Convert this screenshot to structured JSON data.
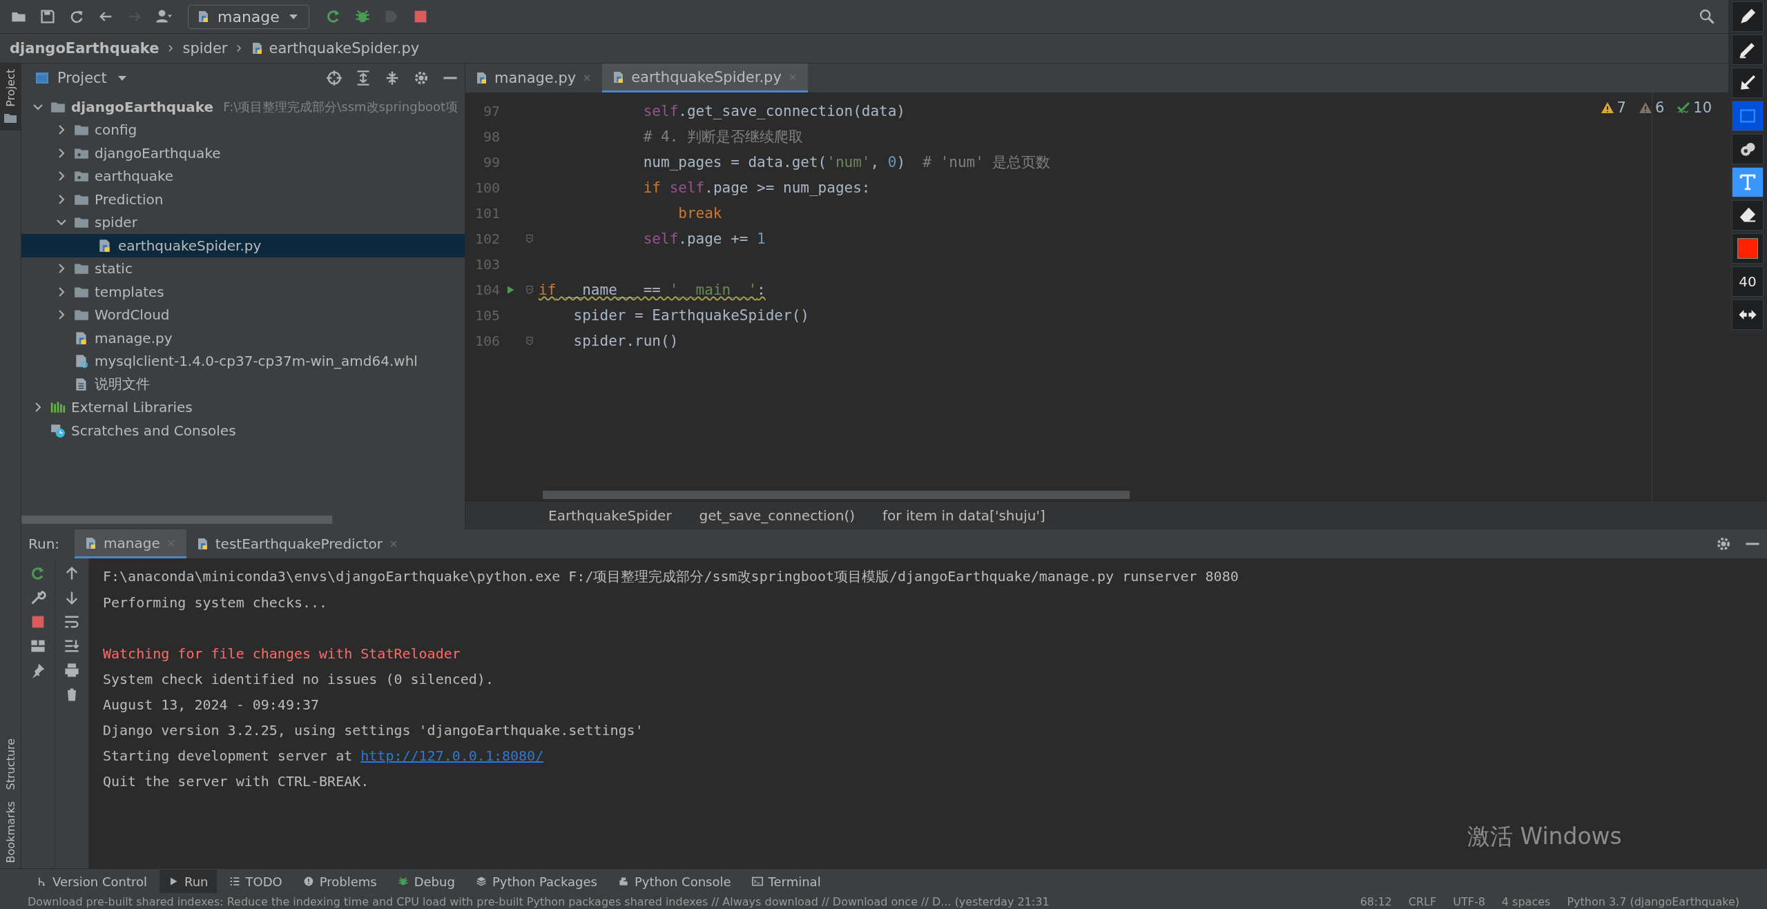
{
  "toolbar": {
    "run_config": "manage",
    "tools": [
      {
        "kind": "open",
        "disabled": false
      },
      {
        "kind": "save",
        "disabled": false
      },
      {
        "kind": "sync",
        "disabled": false
      },
      {
        "kind": "back",
        "disabled": false
      },
      {
        "kind": "forward",
        "disabled": true
      },
      {
        "kind": "user",
        "disabled": false
      }
    ],
    "run_tools": [
      {
        "kind": "rerun",
        "disabled": false
      },
      {
        "kind": "debug",
        "disabled": false
      },
      {
        "kind": "coverage",
        "disabled": true
      },
      {
        "kind": "stop",
        "disabled": false
      }
    ]
  },
  "breadcrumb": [
    {
      "label": "djangoEarthquake",
      "kind": "project"
    },
    {
      "label": "spider",
      "kind": "folder"
    },
    {
      "label": "earthquakeSpider.py",
      "kind": "pyfile"
    }
  ],
  "left_strip": {
    "top": [
      {
        "label": "Project",
        "selected": true
      }
    ],
    "bottom": [
      {
        "label": "Structure",
        "selected": false
      },
      {
        "label": "Bookmarks",
        "selected": false
      }
    ]
  },
  "project": {
    "title": "Project",
    "tree": [
      {
        "label": "djangoEarthquake",
        "path": "F:\\项目整理完成部分\\ssm改springboot项",
        "kind": "folder",
        "expanded": true,
        "selected": false,
        "children": [
          {
            "label": "config",
            "kind": "folder",
            "expanded": false,
            "selected": false
          },
          {
            "label": "djangoEarthquake",
            "kind": "package",
            "expanded": false,
            "selected": false
          },
          {
            "label": "earthquake",
            "kind": "package",
            "expanded": false,
            "selected": false
          },
          {
            "label": "Prediction",
            "kind": "folder",
            "expanded": false,
            "selected": false
          },
          {
            "label": "spider",
            "kind": "folder",
            "expanded": true,
            "selected": false,
            "children": [
              {
                "label": "earthquakeSpider.py",
                "kind": "pyfile",
                "selected": true
              }
            ]
          },
          {
            "label": "static",
            "kind": "folder",
            "expanded": false,
            "selected": false
          },
          {
            "label": "templates",
            "kind": "folder",
            "expanded": false,
            "selected": false
          },
          {
            "label": "WordCloud",
            "kind": "folder",
            "expanded": false,
            "selected": false
          },
          {
            "label": "manage.py",
            "kind": "pyfile",
            "selected": false
          },
          {
            "label": "mysqlclient-1.4.0-cp37-cp37m-win_amd64.whl",
            "kind": "unknown",
            "selected": false
          },
          {
            "label": "说明文件",
            "kind": "text",
            "selected": false
          }
        ]
      },
      {
        "label": "External Libraries",
        "kind": "libraries",
        "expanded": false,
        "selected": false
      },
      {
        "label": "Scratches and Consoles",
        "kind": "scratches",
        "selected": false
      }
    ]
  },
  "editor": {
    "tabs": [
      {
        "label": "manage.py",
        "selected": false
      },
      {
        "label": "earthquakeSpider.py",
        "selected": true
      }
    ],
    "inspections": [
      {
        "kind": "warning",
        "count": "7"
      },
      {
        "kind": "weak",
        "count": "6"
      },
      {
        "kind": "typo",
        "count": "10"
      }
    ],
    "lines": [
      {
        "number": "97",
        "tokens": [
          {
            "t": "            self",
            "kind": "self"
          },
          {
            "t": ".get_save_connection(data)",
            "kind": "plain"
          }
        ]
      },
      {
        "number": "98",
        "tokens": [
          {
            "t": "            # 4. 判断是否继续爬取",
            "kind": "comment"
          }
        ]
      },
      {
        "number": "99",
        "tokens": [
          {
            "t": "            num_pages = data.get(",
            "kind": "plain"
          },
          {
            "t": "'num'",
            "kind": "str"
          },
          {
            "t": ", ",
            "kind": "plain"
          },
          {
            "t": "0",
            "kind": "num"
          },
          {
            "t": ")  ",
            "kind": "plain"
          },
          {
            "t": "# 'num' 是总页数",
            "kind": "comment"
          }
        ]
      },
      {
        "number": "100",
        "tokens": [
          {
            "t": "            if",
            "kind": "kw"
          },
          {
            "t": " self",
            "kind": "self"
          },
          {
            "t": ".page >= num_pages:",
            "kind": "plain"
          }
        ]
      },
      {
        "number": "101",
        "tokens": [
          {
            "t": "                break",
            "kind": "kw"
          }
        ]
      },
      {
        "number": "102",
        "fold": true,
        "tokens": [
          {
            "t": "            self",
            "kind": "self"
          },
          {
            "t": ".page += ",
            "kind": "plain"
          },
          {
            "t": "1",
            "kind": "num"
          }
        ]
      },
      {
        "number": "103"
      },
      {
        "number": "104",
        "run": true,
        "fold": true,
        "underline": true,
        "tokens": [
          {
            "t": "if",
            "kind": "kw"
          },
          {
            "t": " __name__ == ",
            "kind": "plain"
          },
          {
            "t": "'__main__'",
            "kind": "str"
          },
          {
            "t": ":",
            "kind": "plain"
          }
        ]
      },
      {
        "number": "105",
        "tokens": [
          {
            "t": "    spider = EarthquakeSpider()",
            "kind": "plain"
          }
        ]
      },
      {
        "number": "106",
        "fold": true,
        "tokens": [
          {
            "t": "    spider.run()",
            "kind": "plain"
          }
        ]
      }
    ],
    "breadcrumb": [
      "EarthquakeSpider",
      "get_save_connection()",
      "for item in data['shuju']"
    ]
  },
  "run": {
    "label": "Run:",
    "tabs": [
      {
        "label": "manage",
        "selected": true
      },
      {
        "label": "testEarthquakePredictor",
        "selected": false
      }
    ],
    "output": [
      {
        "segments": [
          {
            "t": "F:\\anaconda\\miniconda3\\envs\\djangoEarthquake\\python.exe F:/项目整理完成部分/ssm改springboot项目模版/djangoEarthquake/manage.py runserver 8080",
            "kind": "plain"
          }
        ]
      },
      {
        "segments": [
          {
            "t": "Performing system checks...",
            "kind": "plain"
          }
        ]
      },
      {
        "gap_before": true,
        "segments": [
          {
            "t": "Watching for file changes with StatReloader",
            "kind": "error"
          }
        ]
      },
      {
        "segments": [
          {
            "t": "System check identified no issues (0 silenced).",
            "kind": "plain"
          }
        ]
      },
      {
        "segments": [
          {
            "t": "August 13, 2024 - 09:49:37",
            "kind": "plain"
          }
        ]
      },
      {
        "segments": [
          {
            "t": "Django version 3.2.25, using settings 'djangoEarthquake.settings'",
            "kind": "plain"
          }
        ]
      },
      {
        "segments": [
          {
            "t": "Starting development server at ",
            "kind": "plain"
          },
          {
            "t": "http://127.0.0.1:8080/",
            "kind": "link"
          }
        ]
      },
      {
        "segments": [
          {
            "t": "Quit the server with CTRL-BREAK.",
            "kind": "plain"
          }
        ]
      }
    ]
  },
  "tool_windows": [
    {
      "label": "Version Control",
      "kind": "vcs",
      "selected": false
    },
    {
      "label": "Run",
      "kind": "run",
      "selected": true
    },
    {
      "label": "TODO",
      "kind": "todo",
      "selected": false
    },
    {
      "label": "Problems",
      "kind": "problems",
      "selected": false
    },
    {
      "label": "Debug",
      "kind": "debug",
      "selected": false
    },
    {
      "label": "Python Packages",
      "kind": "packages",
      "selected": false
    },
    {
      "label": "Python Console",
      "kind": "console",
      "selected": false
    },
    {
      "label": "Terminal",
      "kind": "terminal",
      "selected": false
    }
  ],
  "status_bar": {
    "message": "Download pre-built shared indexes: Reduce the indexing time and CPU load with pre-built Python packages shared indexes // Always download // Download once // D... (yesterday 21:31",
    "items": [
      "68:12",
      "CRLF",
      "UTF-8",
      "4 spaces",
      "Python 3.7 (djangoEarthquake)"
    ]
  },
  "activation_notice": "激活 Windows",
  "annotation_toolbar": {
    "tools": [
      {
        "kind": "pen",
        "selected": false,
        "hovered": false
      },
      {
        "kind": "marker",
        "selected": false,
        "hovered": false
      },
      {
        "kind": "arrow",
        "selected": false,
        "hovered": false
      },
      {
        "kind": "rect",
        "selected": false,
        "hovered": true
      },
      {
        "kind": "stamp",
        "selected": false,
        "hovered": false
      },
      {
        "kind": "text",
        "selected": true,
        "hovered": false
      },
      {
        "kind": "eraser",
        "selected": false,
        "hovered": false
      }
    ],
    "color": "#ff2200",
    "size": "40"
  }
}
